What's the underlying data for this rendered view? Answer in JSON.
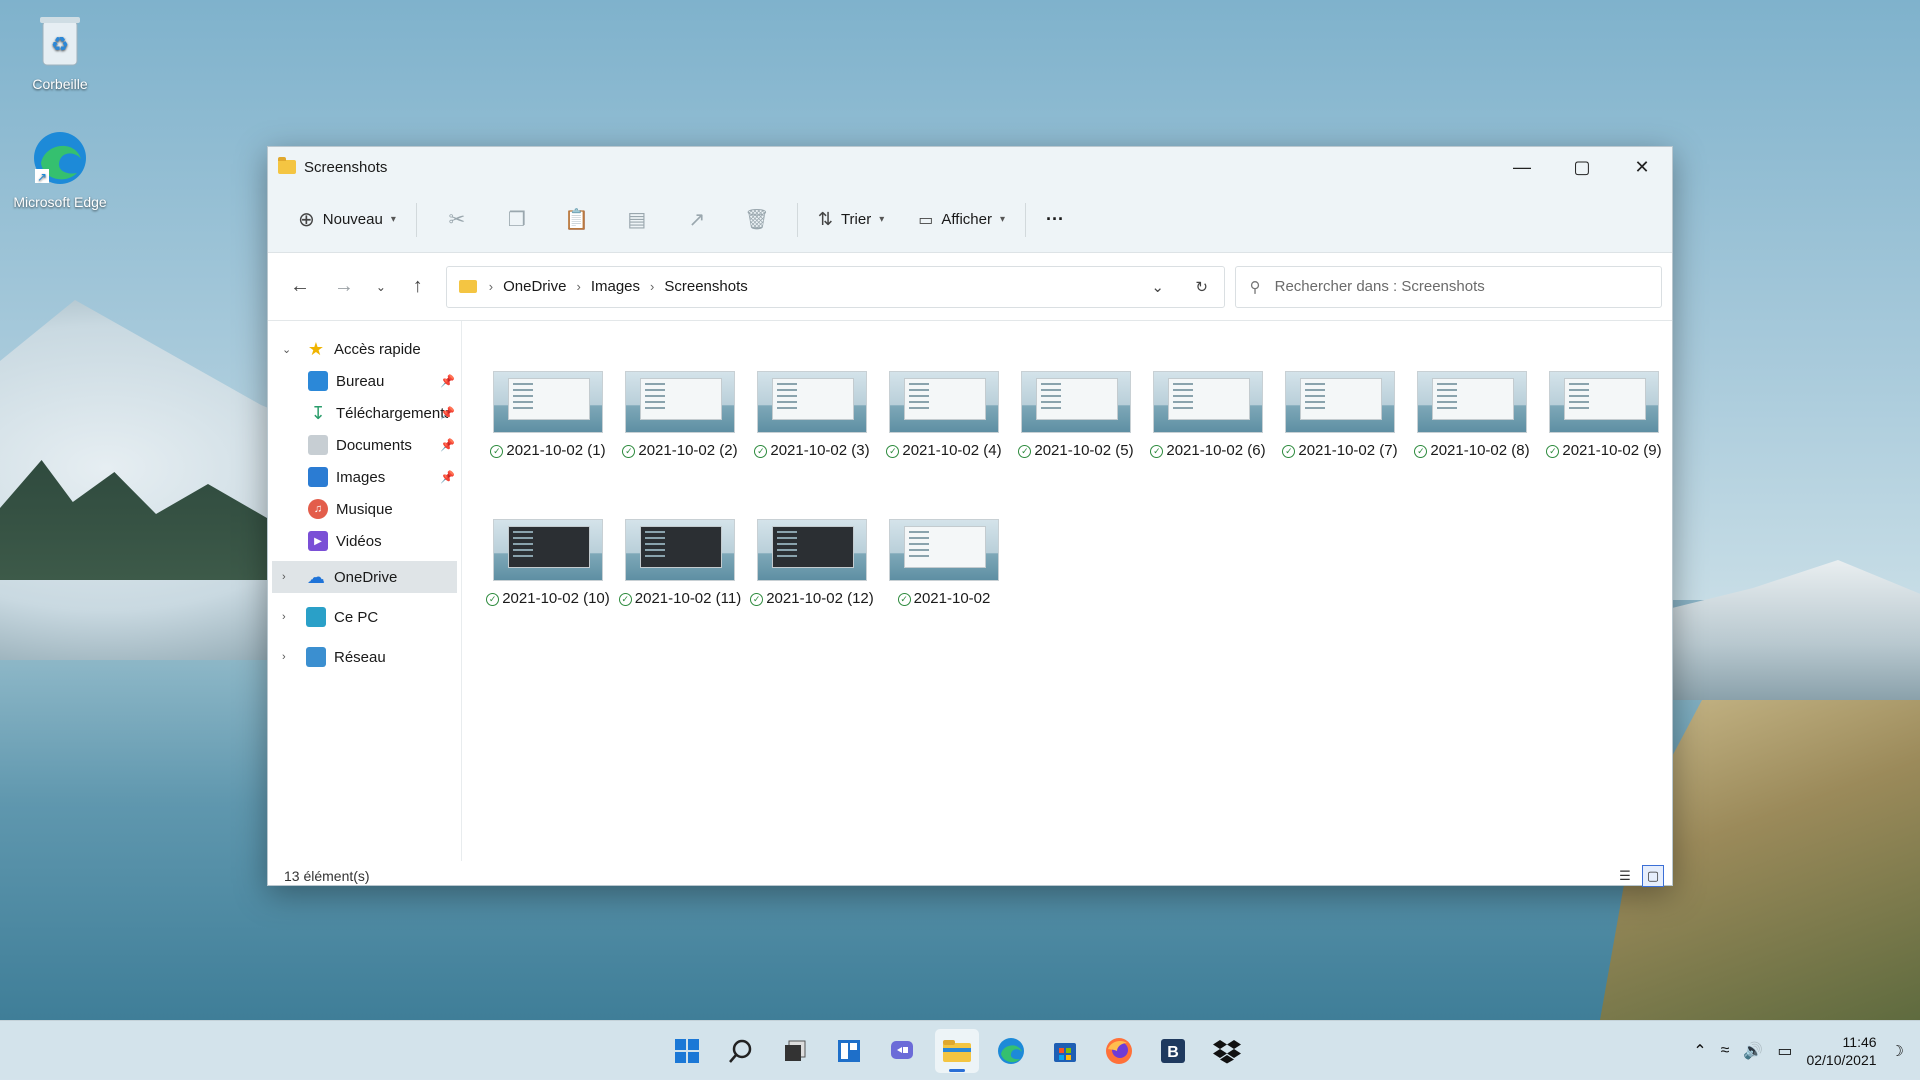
{
  "desktop": {
    "icons": [
      {
        "label": "Corbeille"
      },
      {
        "label": "Microsoft Edge"
      }
    ]
  },
  "window": {
    "title": "Screenshots",
    "toolbar": {
      "new_label": "Nouveau",
      "sort_label": "Trier",
      "view_label": "Afficher",
      "more_label": "···"
    },
    "breadcrumb": [
      "OneDrive",
      "Images",
      "Screenshots"
    ],
    "search_placeholder": "Rechercher dans : Screenshots",
    "nav": {
      "quick_access": "Accès rapide",
      "items": [
        {
          "label": "Bureau",
          "icon": "desktop-icon",
          "color": "#2b88d8"
        },
        {
          "label": "Téléchargements",
          "icon": "download-icon",
          "color": "#2a9d6b"
        },
        {
          "label": "Documents",
          "icon": "document-icon",
          "color": "#8a96a0"
        },
        {
          "label": "Images",
          "icon": "image-icon",
          "color": "#2b7cd3"
        },
        {
          "label": "Musique",
          "icon": "music-icon",
          "color": "#e35d4b"
        },
        {
          "label": "Vidéos",
          "icon": "video-icon",
          "color": "#7a4fd6"
        }
      ],
      "onedrive": "OneDrive",
      "this_pc": "Ce PC",
      "network": "Réseau"
    },
    "files": [
      {
        "name": "2021-10-02 (1)"
      },
      {
        "name": "2021-10-02 (2)"
      },
      {
        "name": "2021-10-02 (3)"
      },
      {
        "name": "2021-10-02 (4)"
      },
      {
        "name": "2021-10-02 (5)"
      },
      {
        "name": "2021-10-02 (6)"
      },
      {
        "name": "2021-10-02 (7)"
      },
      {
        "name": "2021-10-02 (8)"
      },
      {
        "name": "2021-10-02 (9)"
      },
      {
        "name": "2021-10-02 (10)"
      },
      {
        "name": "2021-10-02 (11)"
      },
      {
        "name": "2021-10-02 (12)"
      },
      {
        "name": "2021-10-02"
      }
    ],
    "status": "13 élément(s)"
  },
  "taskbar": {
    "time": "11:46",
    "date": "02/10/2021"
  },
  "colors": {
    "accent": "#2a6fd6",
    "folder": "#f4c542",
    "sync_ok": "#2e8b3e"
  }
}
